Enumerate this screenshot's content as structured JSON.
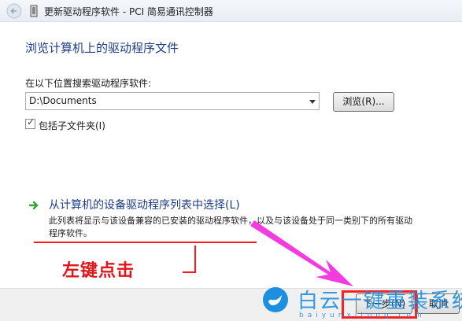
{
  "window": {
    "title": "更新驱动程序软件 - PCI 简易通讯控制器"
  },
  "page": {
    "heading": "浏览计算机上的驱动程序文件",
    "search_label": "在以下位置搜索驱动程序软件:",
    "path_value": "D:\\Documents",
    "browse_label": "浏览(R)...",
    "include_subfolders_label": "包括子文件夹(I)",
    "include_subfolders_checked": true
  },
  "pick_option": {
    "title": "从计算机的设备驱动程序列表中选择(L)",
    "description": "此列表将显示与该设备兼容的已安装的驱动程序软件，以及与该设备处于同一类别下的所有驱动程序软件。"
  },
  "annotation": {
    "text": "左键点击",
    "color": "#e2151a",
    "arrow_color": "#f23ce0"
  },
  "footer": {
    "next_label": "下一步(N)",
    "cancel_label": "取消"
  },
  "watermark": {
    "text": "白云一键重装系统",
    "url": "baiyunxitong.com",
    "color": "#1d8fe0"
  },
  "colors": {
    "link_blue": "#1e3e8a",
    "accent_green": "#2fa83a"
  },
  "icons": {
    "back": "back-arrow-icon",
    "device": "device-icon",
    "option": "green-arrow-icon",
    "watermark": "bird-logo-icon"
  }
}
